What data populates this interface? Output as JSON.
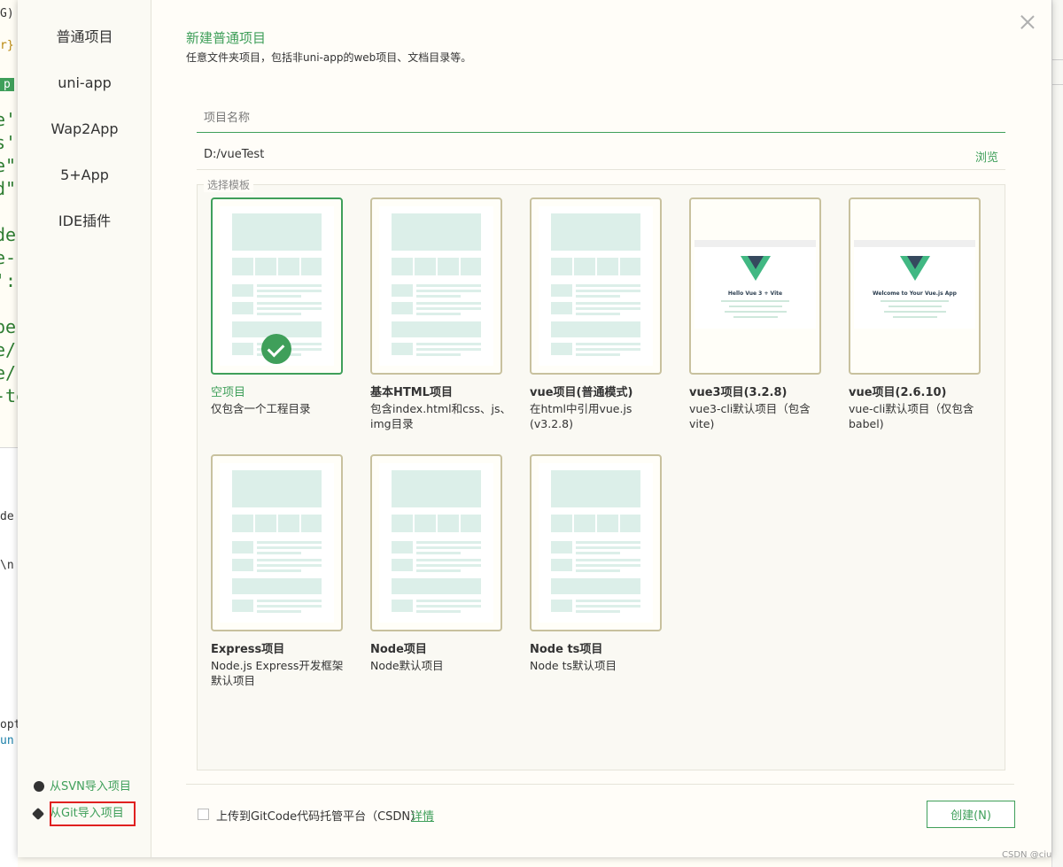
{
  "background": {
    "code_lines": [
      "e'",
      "s'",
      "e\"",
      "d\"",
      "der",
      "e-",
      "':",
      "per",
      "e/",
      "e/",
      "-te"
    ],
    "top_fragments": [
      "G)",
      "r}",
      "p"
    ],
    "lower_lines": [
      "de",
      "\\n",
      "opt",
      "un"
    ]
  },
  "sidebar": {
    "items": [
      {
        "label": "普通项目",
        "active": true
      },
      {
        "label": "uni-app",
        "active": false
      },
      {
        "label": "Wap2App",
        "active": false
      },
      {
        "label": "5+App",
        "active": false
      },
      {
        "label": "IDE插件",
        "active": false
      }
    ],
    "svn_import": "从SVN导入项目",
    "git_import": "从Git导入项目"
  },
  "header": {
    "title": "新建普通项目",
    "subtitle": "任意文件夹项目，包括非uni-app的web项目、文档目录等。"
  },
  "form": {
    "name_placeholder": "项目名称",
    "path_value": "D:/vueTest",
    "browse_label": "浏览"
  },
  "templates": {
    "legend": "选择模板",
    "items": [
      {
        "name": "空项目",
        "desc": "仅包含一个工程目录",
        "selected": true,
        "thumb": "wireframe"
      },
      {
        "name": "基本HTML项目",
        "desc": "包含index.html和css、js、img目录",
        "selected": false,
        "thumb": "wireframe"
      },
      {
        "name": "vue项目(普通模式)",
        "desc": "在html中引用vue.js (v3.2.8)",
        "selected": false,
        "thumb": "wireframe"
      },
      {
        "name": "vue3项目(3.2.8)",
        "desc": "vue3-cli默认项目（包含vite)",
        "selected": false,
        "thumb": "vue",
        "thumb_title": "Hello Vue 3 + Vite"
      },
      {
        "name": "vue项目(2.6.10)",
        "desc": "vue-cli默认项目（仅包含babel)",
        "selected": false,
        "thumb": "vue",
        "thumb_title": "Welcome to Your Vue.js App"
      },
      {
        "name": "Express项目",
        "desc": "Node.js Express开发框架默认项目",
        "selected": false,
        "thumb": "wireframe"
      },
      {
        "name": "Node项目",
        "desc": "Node默认项目",
        "selected": false,
        "thumb": "wireframe"
      },
      {
        "name": "Node ts项目",
        "desc": "Node ts默认项目",
        "selected": false,
        "thumb": "wireframe"
      }
    ]
  },
  "footer": {
    "upload_label": "上传到GitCode代码托管平台（CSDN）",
    "detail_link": "详情",
    "create_button": "创建(N)"
  },
  "watermark": "CSDN @ciu",
  "colors": {
    "accent": "#3f9f5a",
    "highlight_box": "#e02020",
    "card_border": "#c8c19e"
  }
}
